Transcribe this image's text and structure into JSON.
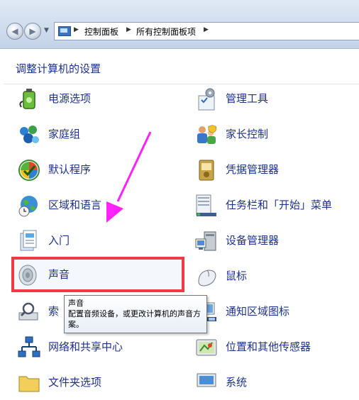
{
  "address_bar": {
    "breadcrumbs": [
      "控制面板",
      "所有控制面板项"
    ]
  },
  "heading": "调整计算机的设置",
  "items": [
    {
      "label": "电源选项",
      "icon": "power-options-icon"
    },
    {
      "label": "管理工具",
      "icon": "admin-tools-icon"
    },
    {
      "label": "家庭组",
      "icon": "homegroup-icon"
    },
    {
      "label": "家长控制",
      "icon": "parental-controls-icon"
    },
    {
      "label": "默认程序",
      "icon": "default-programs-icon"
    },
    {
      "label": "凭据管理器",
      "icon": "credential-manager-icon"
    },
    {
      "label": "区域和语言",
      "icon": "region-language-icon"
    },
    {
      "label": "任务栏和「开始」菜单",
      "icon": "taskbar-icon"
    },
    {
      "label": "入门",
      "icon": "getting-started-icon"
    },
    {
      "label": "设备管理器",
      "icon": "device-manager-icon"
    },
    {
      "label": "声音",
      "icon": "speaker-icon"
    },
    {
      "label": "鼠标",
      "icon": "mouse-icon"
    },
    {
      "label": "索",
      "icon": "indexing-icon"
    },
    {
      "label": "通知区域图标",
      "icon": "notification-area-icon"
    },
    {
      "label": "网络和共享中心",
      "icon": "network-icon"
    },
    {
      "label": "位置和其他传感器",
      "icon": "location-sensors-icon"
    },
    {
      "label": "文件夹选项",
      "icon": "folder-options-icon"
    },
    {
      "label": "系统",
      "icon": "system-icon"
    }
  ],
  "tooltip": {
    "title": "声音",
    "body": "配置音频设备，或更改计算机的声音方案。"
  },
  "colors": {
    "link": "#1e3287",
    "highlight_border": "#ee3a43",
    "annotation_arrow": "#ff22ff"
  }
}
